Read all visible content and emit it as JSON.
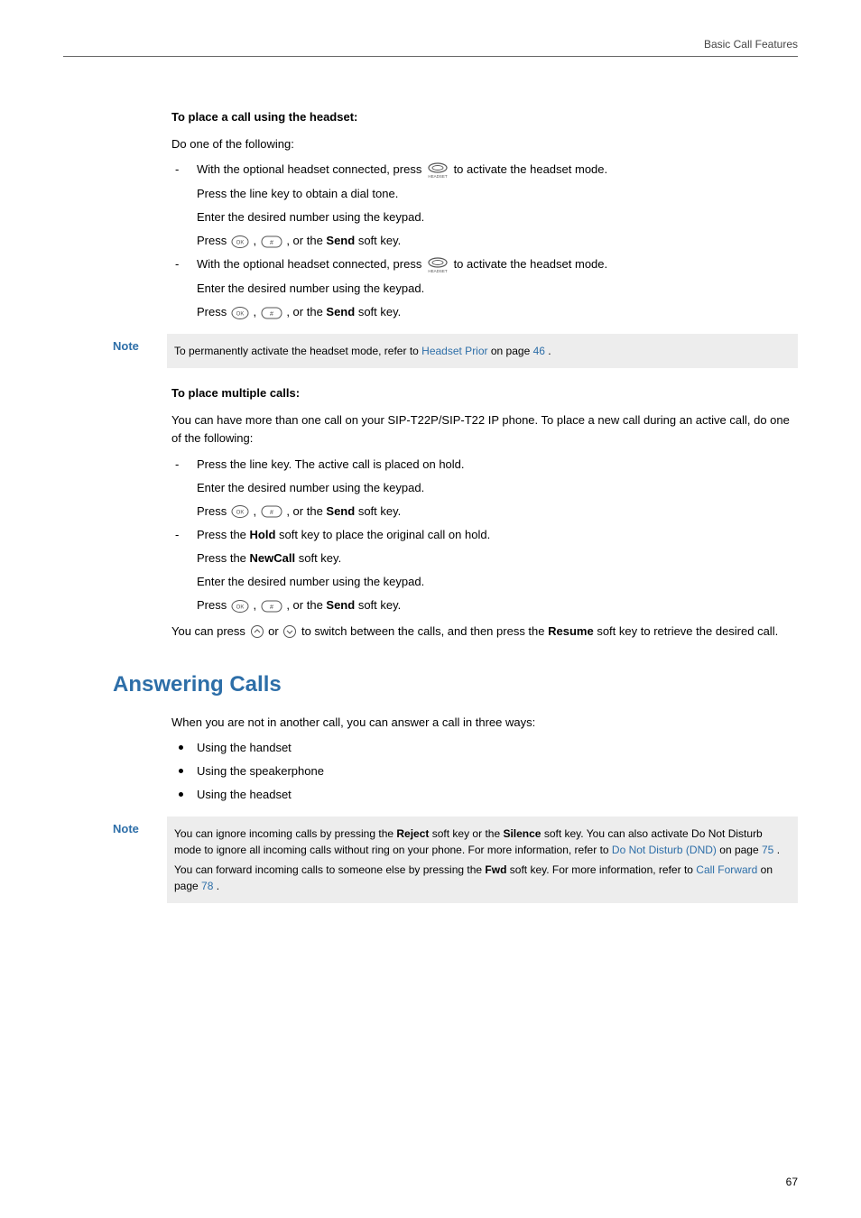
{
  "running_header": "Basic Call Features",
  "page_number": "67",
  "sec1": {
    "heading": "To place a call using the headset:",
    "intro": "Do one of the following:",
    "item1_a": "With the optional headset connected, press ",
    "item1_b": " to activate the headset mode.",
    "item1_line2": "Press the line key to obtain a dial tone.",
    "item1_line3": "Enter the desired number using the keypad.",
    "press_label": "Press ",
    "or_the": " , or the ",
    "send": "Send",
    "softkey_tail": " soft key.",
    "item2_a": "With the optional headset connected, press ",
    "item2_b": " to activate the headset mode.",
    "item2_line2": "Enter the desired number using the keypad."
  },
  "note1": {
    "label": "Note",
    "text_a": "To permanently activate the headset mode, refer to ",
    "link": "Headset Prior",
    "text_b": " on page ",
    "page": "46",
    "tail": "."
  },
  "sec2": {
    "heading": "To place multiple calls:",
    "intro": "You can have more than one call on your SIP-T22P/SIP-T22 IP phone. To place a new call during an active call, do one of the following:",
    "item1_line1": "Press the line key. The active call is placed on hold.",
    "item1_line2": "Enter the desired number using the keypad.",
    "item2_line1_a": "Press the ",
    "hold": "Hold",
    "item2_line1_b": " soft key to place the original call on hold.",
    "item2_line2_a": "Press the ",
    "newcall": "NewCall",
    "item2_line2_b": " soft key.",
    "item2_line3": "Enter the desired number using the keypad.",
    "closing_a": "You can press ",
    "closing_b": " or ",
    "closing_c": " to switch between the calls, and then press the ",
    "resume": "Resume",
    "closing_d": " soft key to retrieve the desired call."
  },
  "answering": {
    "title": "Answering Calls",
    "intro": "When you are not in another call, you can answer a call in three ways:",
    "ways": [
      "Using the handset",
      "Using the speakerphone",
      "Using the headset"
    ]
  },
  "note2": {
    "label": "Note",
    "p1_a": "You can ignore incoming calls by pressing the ",
    "reject": "Reject",
    "p1_b": " soft key or the ",
    "silence": "Silence",
    "p1_c": " soft key. You can also activate Do Not Disturb mode to ignore all incoming calls without ring on your phone. For more information, refer to ",
    "dnd_link": "Do Not Disturb (DND)",
    "p1_d": " on page ",
    "dnd_page": "75",
    "p1_e": ".",
    "p2_a": "You can forward incoming calls to someone else by pressing the ",
    "fwd": "Fwd",
    "p2_b": " soft key. For more information, refer to ",
    "fwd_link": "Call Forward",
    "p2_c": " on page ",
    "fwd_page": "78",
    "p2_d": "."
  }
}
